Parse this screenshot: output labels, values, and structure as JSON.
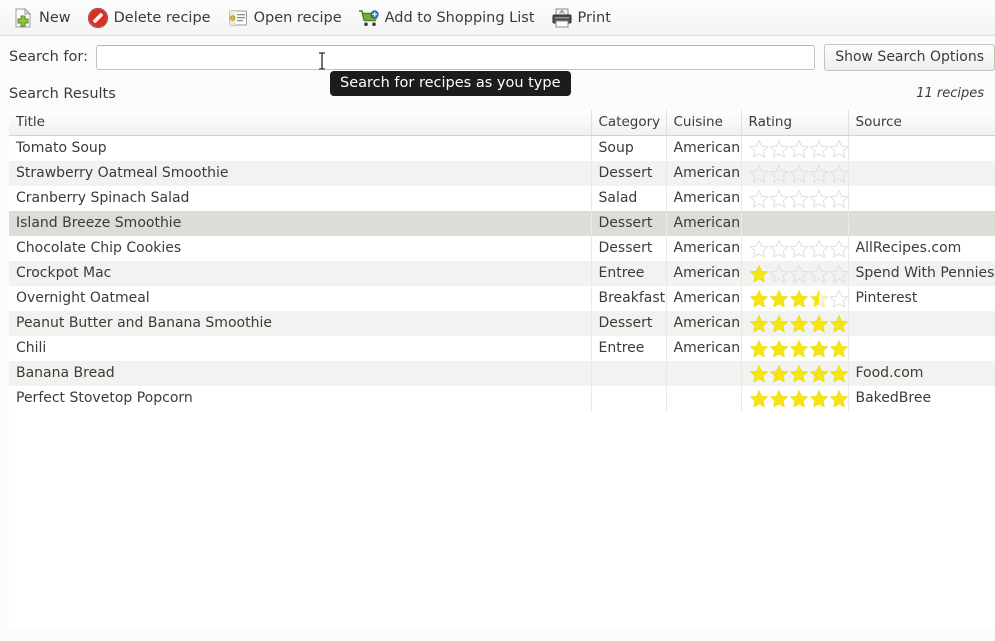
{
  "toolbar": {
    "items": [
      {
        "label": "New",
        "icon": "new-document-icon"
      },
      {
        "label": "Delete recipe",
        "icon": "delete-forbidden-icon"
      },
      {
        "label": "Open recipe",
        "icon": "open-folder-icon"
      },
      {
        "label": "Add to Shopping List",
        "icon": "shopping-cart-icon"
      },
      {
        "label": "Print",
        "icon": "printer-icon"
      }
    ]
  },
  "search": {
    "label": "Search for:",
    "value": "",
    "placeholder": "",
    "options_button": "Show Search Options",
    "tooltip": "Search for recipes as you type"
  },
  "results": {
    "title": "Search Results",
    "count_label": "11 recipes"
  },
  "table": {
    "columns": [
      "Title",
      "Category",
      "Cuisine",
      "Rating",
      "Source"
    ],
    "rows": [
      {
        "title": "Tomato Soup",
        "category": "Soup",
        "cuisine": "American",
        "rating": 0,
        "source": ""
      },
      {
        "title": "Strawberry Oatmeal Smoothie",
        "category": "Dessert",
        "cuisine": "American",
        "rating": 0,
        "source": ""
      },
      {
        "title": "Cranberry Spinach Salad",
        "category": "Salad",
        "cuisine": "American",
        "rating": 0,
        "source": ""
      },
      {
        "title": "Island Breeze Smoothie",
        "category": "Dessert",
        "cuisine": "American",
        "rating": 0,
        "source": ""
      },
      {
        "title": "Chocolate Chip Cookies",
        "category": "Dessert",
        "cuisine": "American",
        "rating": 0,
        "source": "AllRecipes.com"
      },
      {
        "title": "Crockpot Mac",
        "category": "Entree",
        "cuisine": "American",
        "rating": 1,
        "source": "Spend With Pennies"
      },
      {
        "title": "Overnight Oatmeal",
        "category": "Breakfast",
        "cuisine": "American",
        "rating": 3.5,
        "source": "Pinterest"
      },
      {
        "title": "Peanut Butter and Banana Smoothie",
        "category": "Dessert",
        "cuisine": "American",
        "rating": 5,
        "source": ""
      },
      {
        "title": "Chili",
        "category": "Entree",
        "cuisine": "American",
        "rating": 5,
        "source": ""
      },
      {
        "title": "Banana Bread",
        "category": "",
        "cuisine": "",
        "rating": 5,
        "source": "Food.com"
      },
      {
        "title": "Perfect Stovetop Popcorn",
        "category": "",
        "cuisine": "",
        "rating": 5,
        "source": "BakedBree"
      }
    ],
    "selected_row_index": 3,
    "max_rating": 5
  },
  "colors": {
    "star_filled": "#f5e513",
    "star_empty": "#e0e0dc",
    "toolbar_bg": "#f6f5f4",
    "row_alt": "#f2f2f0",
    "row_selected": "#dedcd9",
    "text": "#3c3b37",
    "tooltip_bg": "#1c1c1c"
  }
}
